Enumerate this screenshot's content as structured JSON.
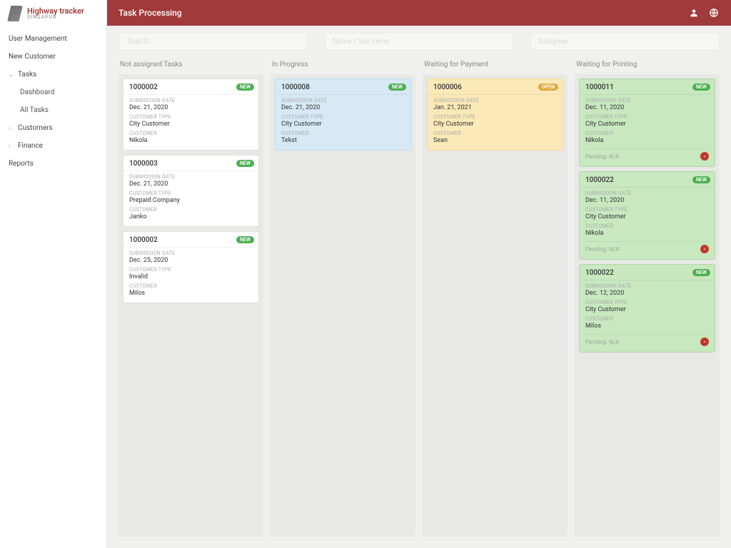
{
  "brand": {
    "title": "Highway tracker",
    "subtitle": "SINGAPUR"
  },
  "nav": {
    "user_management": "User Management",
    "new_customer": "New Customer",
    "tasks": "Tasks",
    "dashboard": "Dashboard",
    "all_tasks": "All Tasks",
    "customers": "Customers",
    "finance": "Finance",
    "reports": "Reports"
  },
  "header": {
    "title": "Task Processing"
  },
  "filters": {
    "task_id": "Task ID",
    "name_lastname": "Name / last name",
    "assignee": "Assignee"
  },
  "labels": {
    "submission_date": "SUBMISSION DATE",
    "customer_type": "CUSTOMER TYPE",
    "customer": "CUSTOMER",
    "pending": "Pending: N/A"
  },
  "badges": {
    "new": "NEW",
    "open": "OPEN"
  },
  "columns": {
    "not_assigned": {
      "title": "Not assigned Tasks"
    },
    "in_progress": {
      "title": "In Progress"
    },
    "waiting_payment": {
      "title": "Waiting for Payment"
    },
    "waiting_printing": {
      "title": "Waiting for Printing"
    }
  },
  "cards": {
    "na1": {
      "id": "1000002",
      "date": "Dec. 21, 2020",
      "ctype": "City Customer",
      "customer": "Nikola"
    },
    "na2": {
      "id": "1000003",
      "date": "Dec. 21, 2020",
      "ctype": "Prepaid Company",
      "customer": "Janko"
    },
    "na3": {
      "id": "1000002",
      "date": "Dec. 25, 2020",
      "ctype": "Invalid",
      "customer": "Milos"
    },
    "ip1": {
      "id": "1000008",
      "date": "Dec. 21, 2020",
      "ctype": "City Customer",
      "customer": "Tekst"
    },
    "wp1": {
      "id": "1000006",
      "date": "Jan. 21, 2021",
      "ctype": "City Customer",
      "customer": "Sean"
    },
    "pr1": {
      "id": "1000011",
      "date": "Dec. 11, 2020",
      "ctype": "City Customer",
      "customer": "Nikola"
    },
    "pr2": {
      "id": "1000022",
      "date": "Dec. 11, 2020",
      "ctype": "City Customer",
      "customer": "Nikola"
    },
    "pr3": {
      "id": "1000022",
      "date": "Dec. 12, 2020",
      "ctype": "City Customer",
      "customer": "Milos"
    }
  }
}
